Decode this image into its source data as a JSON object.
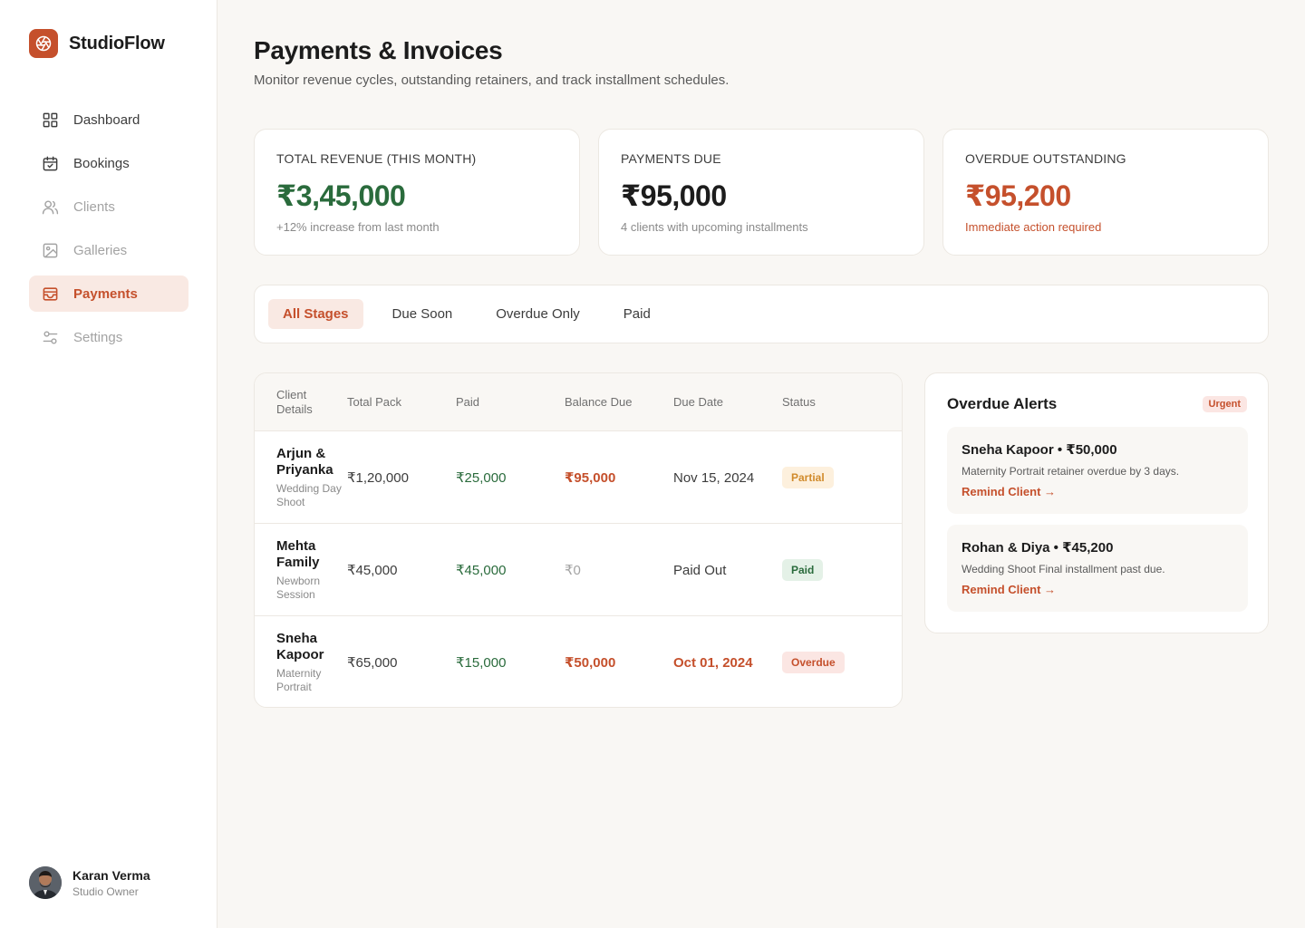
{
  "brand": {
    "name": "StudioFlow",
    "accent": "#c5502c"
  },
  "nav": {
    "items": [
      {
        "label": "Dashboard",
        "icon": "grid-icon"
      },
      {
        "label": "Bookings",
        "icon": "calendar-check-icon"
      },
      {
        "label": "Clients",
        "icon": "users-icon"
      },
      {
        "label": "Galleries",
        "icon": "image-icon"
      },
      {
        "label": "Payments",
        "icon": "wallet-icon",
        "active": true
      },
      {
        "label": "Settings",
        "icon": "sliders-icon"
      }
    ]
  },
  "user": {
    "name": "Karan Verma",
    "role": "Studio Owner"
  },
  "header": {
    "title": "Payments & Invoices",
    "subtitle": "Monitor revenue cycles, outstanding retainers, and track installment schedules."
  },
  "stats": [
    {
      "label": "Total Revenue (This Month)",
      "value": "₹3,45,000",
      "note": "+12% increase from last month",
      "color": "#2a6b3c"
    },
    {
      "label": "Payments Due",
      "value": "₹95,000",
      "note": "4 clients with upcoming installments",
      "color": "#1c1c1c"
    },
    {
      "label": "Overdue Outstanding",
      "value": "₹95,200",
      "note": "Immediate action required",
      "color": "#c5502c"
    }
  ],
  "filters": [
    "All Stages",
    "Due Soon",
    "Overdue Only",
    "Paid"
  ],
  "table": {
    "headers": {
      "client": "Client Details",
      "total": "Total Pack",
      "paid": "Paid",
      "balance": "Balance Due",
      "due": "Due Date",
      "status": "Status"
    },
    "rows": [
      {
        "name": "Arjun & Priyanka",
        "type": "Wedding Day Shoot",
        "total": "₹1,20,000",
        "paid": "₹25,000",
        "balance": "₹95,000",
        "due": "Nov 15, 2024",
        "status": "Partial"
      },
      {
        "name": "Mehta Family",
        "type": "Newborn Session",
        "total": "₹45,000",
        "paid": "₹45,000",
        "balance": "₹0",
        "due": "Paid Out",
        "status": "Paid"
      },
      {
        "name": "Sneha Kapoor",
        "type": "Maternity Portrait",
        "total": "₹65,000",
        "paid": "₹15,000",
        "balance": "₹50,000",
        "due": "Oct 01, 2024",
        "status": "Overdue"
      }
    ]
  },
  "alerts": {
    "title": "Overdue Alerts",
    "badge": "Urgent",
    "items": [
      {
        "head": "Sneha Kapoor • ₹50,000",
        "desc": "Maternity Portrait retainer overdue by 3 days.",
        "link": "Remind Client →"
      },
      {
        "head": "Rohan & Diya • ₹45,200",
        "desc": "Wedding Shoot Final installment past due.",
        "link": "Remind Client →"
      }
    ]
  }
}
